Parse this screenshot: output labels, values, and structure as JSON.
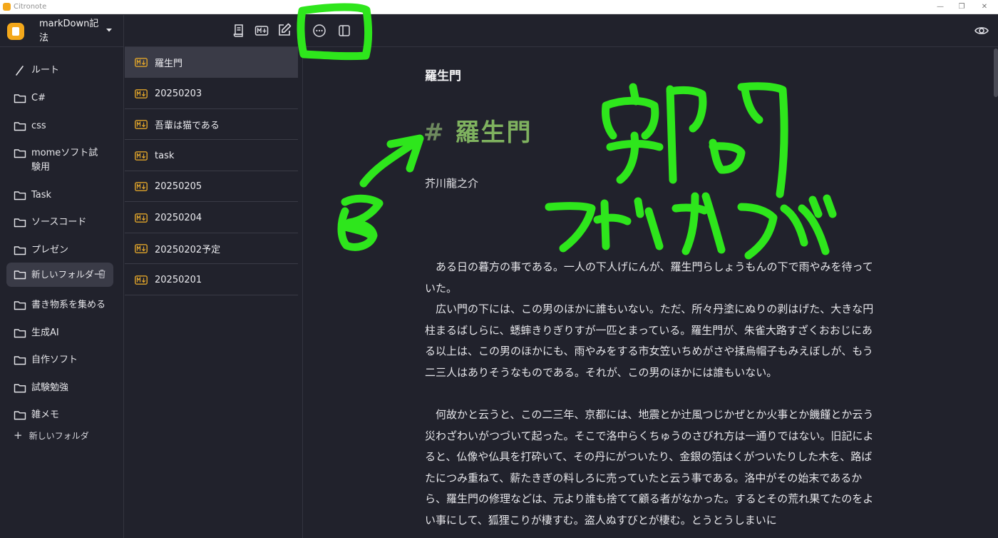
{
  "window": {
    "title": "Citronote"
  },
  "workspace": {
    "name": "markDown記法"
  },
  "sidebar": {
    "root_label": "ルート",
    "folders": [
      {
        "label": "C#"
      },
      {
        "label": "css"
      },
      {
        "label": "momeソフト試験用"
      },
      {
        "label": "Task"
      },
      {
        "label": "ソースコード"
      },
      {
        "label": "プレゼン"
      },
      {
        "label": "新しいフォルダー",
        "active": true
      },
      {
        "label": "書き物系を集める"
      },
      {
        "label": "生成AI"
      },
      {
        "label": "自作ソフト"
      },
      {
        "label": "試験勉強"
      },
      {
        "label": "雑メモ"
      }
    ],
    "new_folder_label": "新しいフォルダ"
  },
  "notes": [
    {
      "title": "羅生門",
      "active": true
    },
    {
      "title": "20250203"
    },
    {
      "title": "吾輩は猫である"
    },
    {
      "title": "task"
    },
    {
      "title": "20250205"
    },
    {
      "title": "20250204"
    },
    {
      "title": "20250202予定"
    },
    {
      "title": "20250201"
    }
  ],
  "icons": {
    "list_toolbar": [
      "document-icon",
      "markdown-add-icon",
      "edit-icon"
    ],
    "editor_toolbar": [
      "more-options-icon",
      "sidebar-toggle-icon",
      "preview-eye-icon"
    ]
  },
  "editor": {
    "title": "羅生門",
    "heading_marker": "#",
    "heading": "羅生門",
    "author": "芥川龍之介",
    "paragraphs": [
      "　ある日の暮方の事である。一人の下人げにんが、羅生門らしょうもんの下で雨やみを待っていた。\n　広い門の下には、この男のほかに誰もいない。ただ、所々丹塗にぬりの剥はげた、大きな円柱まるばしらに、蟋蟀きりぎりすが一匹とまっている。羅生門が、朱雀大路すざくおおじにある以上は、この男のほかにも、雨やみをする市女笠いちめがさや揉烏帽子もみえぼしが、もう二三人はありそうなものである。それが、この男のほかには誰もいない。",
      "　何故かと云うと、この二三年、京都には、地震とか辻風つじかぜとか火事とか饑饉とか云う災わざわいがつづいて起った。そこで洛中らくちゅうのさびれ方は一通りではない。旧記によると、仏像や仏具を打砕いて、その丹にがついたり、金銀の箔はくがついたりした木を、路ばたにつみ重ねて、薪たきぎの料しろに売っていたと云う事である。洛中がその始末であるから、羅生門の修理などは、元より誰も捨てて顧る者がなかった。するとその荒れ果てたのをよい事にして、狐狸こりが棲すむ。盗人ぬすびとが棲む。とうとうしまいに"
    ]
  },
  "colors": {
    "background": "#21222c",
    "selected": "#3a3b47",
    "accent": "#f4a81b",
    "heading_green": "#7fb25f",
    "annotation_green": "#2ee61c"
  }
}
